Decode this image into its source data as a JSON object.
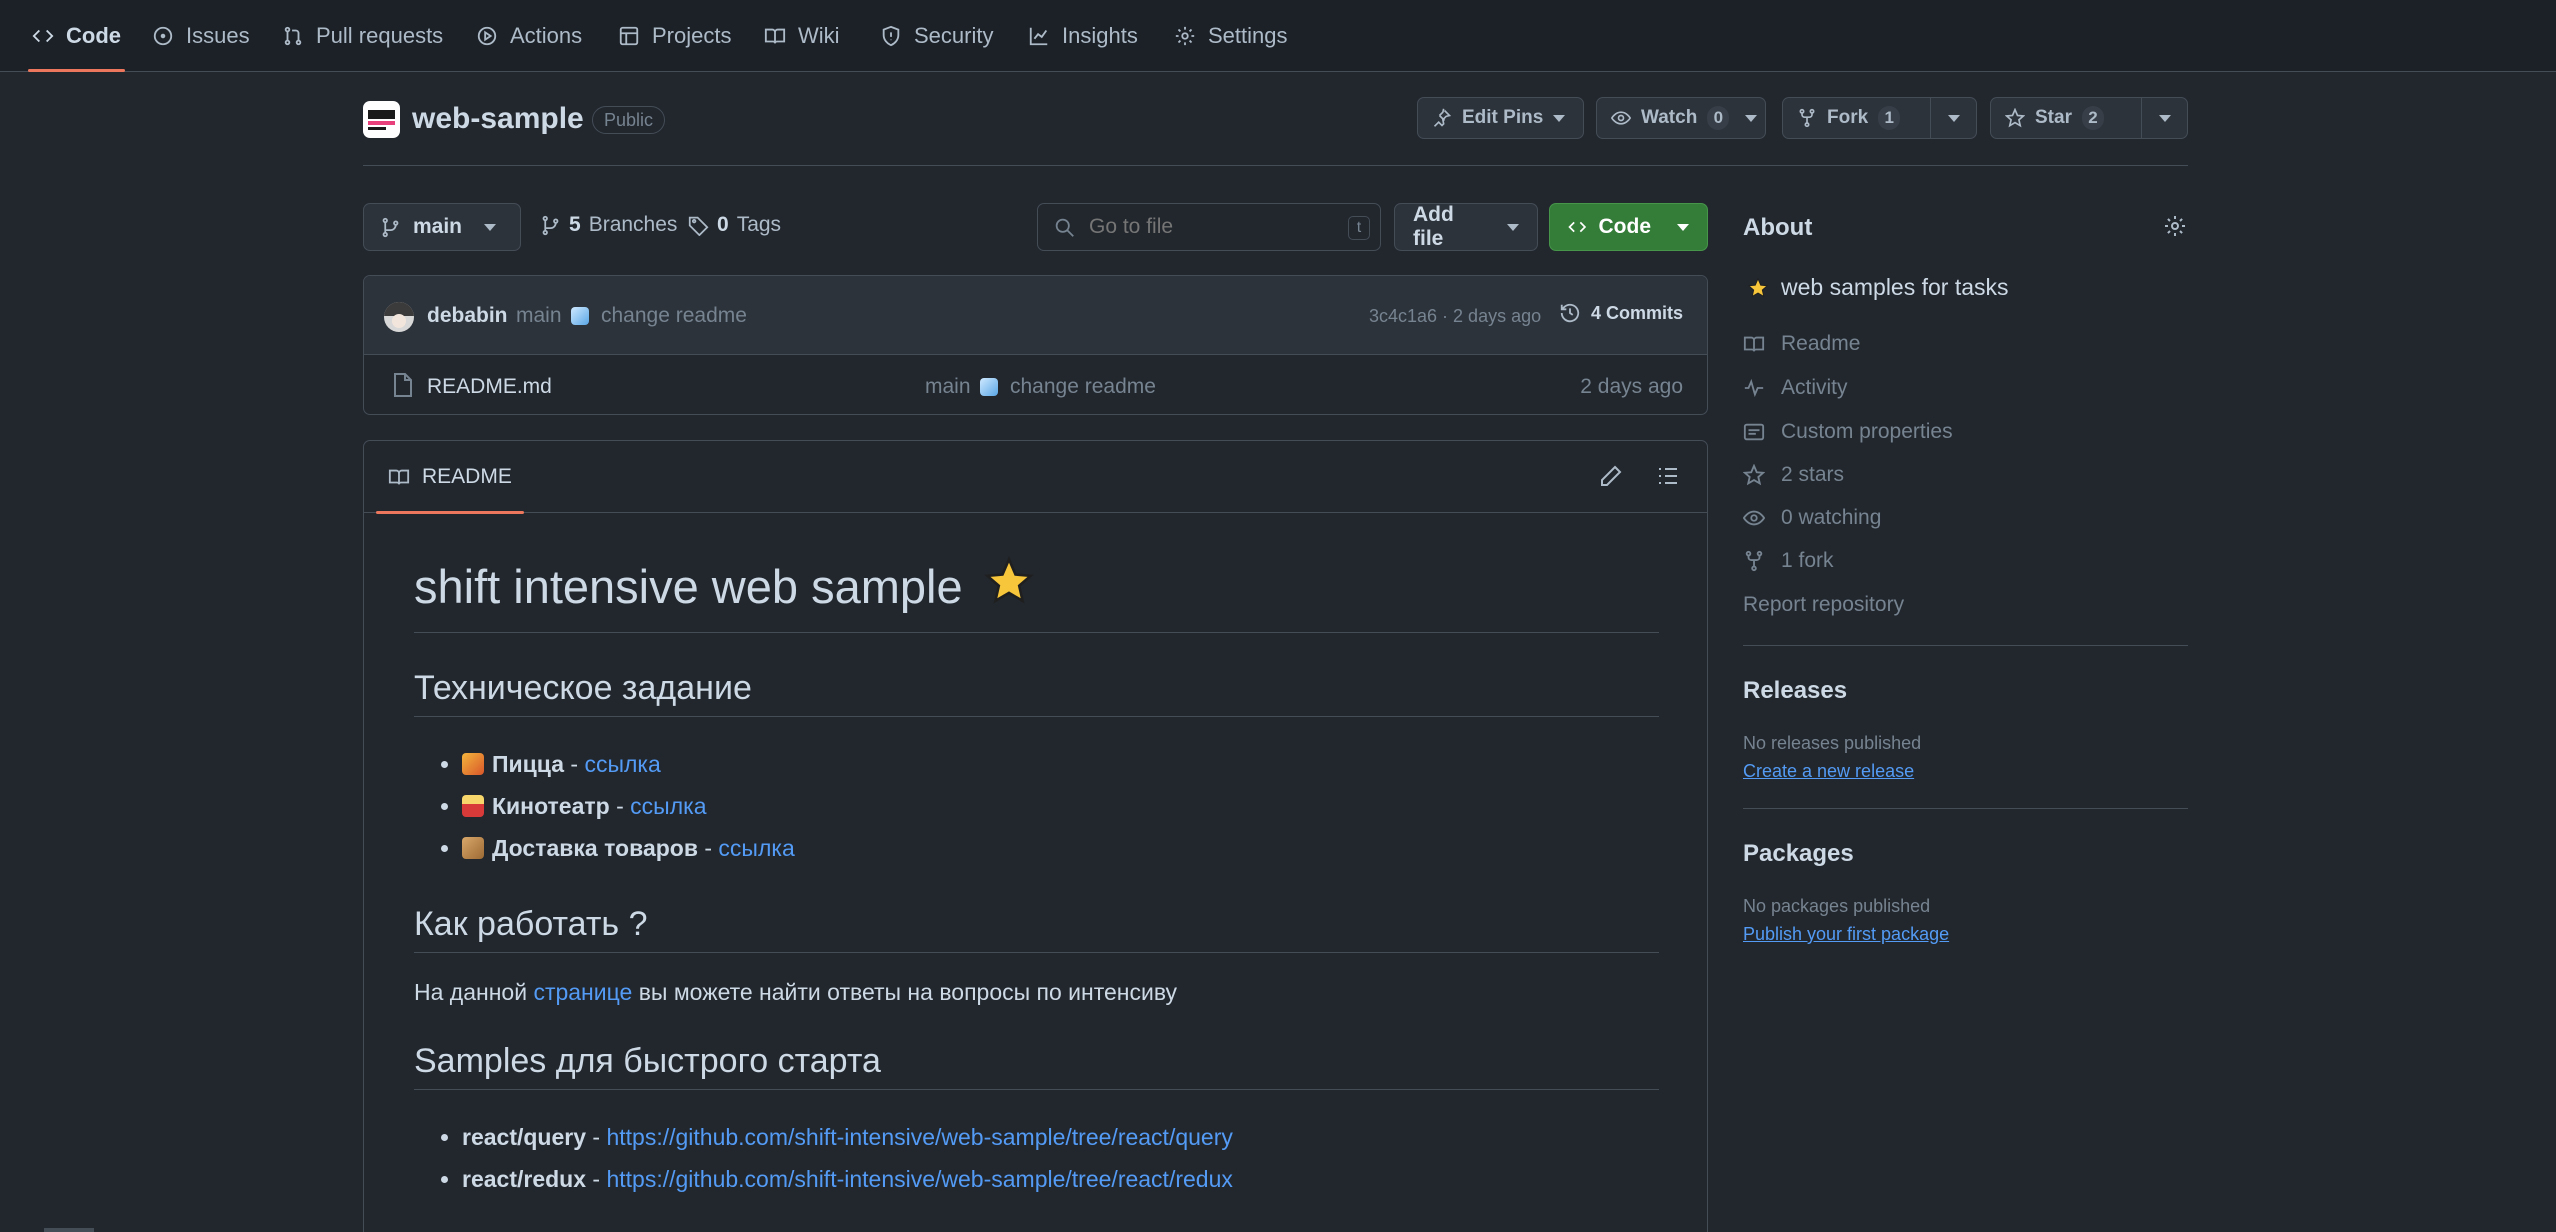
{
  "nav": {
    "tabs": [
      {
        "label": "Code",
        "icon": "code-icon"
      },
      {
        "label": "Issues",
        "icon": "issue-icon"
      },
      {
        "label": "Pull requests",
        "icon": "pull-request-icon"
      },
      {
        "label": "Actions",
        "icon": "play-icon"
      },
      {
        "label": "Projects",
        "icon": "table-icon"
      },
      {
        "label": "Wiki",
        "icon": "book-icon"
      },
      {
        "label": "Security",
        "icon": "shield-icon"
      },
      {
        "label": "Insights",
        "icon": "graph-icon"
      },
      {
        "label": "Settings",
        "icon": "gear-icon"
      }
    ],
    "active": "Code"
  },
  "repo": {
    "name": "web-sample",
    "visibility": "Public",
    "edit_pins_label": "Edit Pins",
    "watch_label": "Watch",
    "watch_count": "0",
    "fork_label": "Fork",
    "fork_count": "1",
    "star_label": "Star",
    "star_count": "2"
  },
  "toolbar": {
    "branch": "main",
    "branches_count": "5",
    "branches_label": "Branches",
    "tags_count": "0",
    "tags_label": "Tags",
    "search_placeholder": "Go to file",
    "search_shortcut": "t",
    "add_file_label": "Add file",
    "code_label": "Code"
  },
  "commit": {
    "author": "debabin",
    "branch": "main",
    "message": "change readme",
    "hash_time": "3c4c1a6 · 2 days ago",
    "commits_label": "4 Commits"
  },
  "files": [
    {
      "name": "README.md",
      "branch": "main",
      "message": "change readme",
      "time": "2 days ago"
    }
  ],
  "readme": {
    "tab_label": "README",
    "title": "shift intensive web sample",
    "h2_task": "Техническое задание",
    "tasks": [
      {
        "name": "Пицца",
        "sep": " - ",
        "link": "ссылка",
        "emoji": "pizza"
      },
      {
        "name": "Кинотеатр",
        "sep": " - ",
        "link": "ссылка",
        "emoji": "popcorn"
      },
      {
        "name": "Доставка товаров",
        "sep": " - ",
        "link": "ссылка",
        "emoji": "package"
      }
    ],
    "h2_how": "Как работать ?",
    "how_pre": "На данной ",
    "how_link": "странице",
    "how_post": " вы можете найти ответы на вопросы по интенсиву",
    "h2_samples": "Samples для быстрого старта",
    "samples": [
      {
        "name": "react/query",
        "sep": " - ",
        "url": "https://github.com/shift-intensive/web-sample/tree/react/query"
      },
      {
        "name": "react/redux",
        "sep": " - ",
        "url": "https://github.com/shift-intensive/web-sample/tree/react/redux"
      }
    ]
  },
  "about": {
    "title": "About",
    "description": "web samples for tasks",
    "items": [
      {
        "label": "Readme",
        "icon": "book-icon"
      },
      {
        "label": "Activity",
        "icon": "pulse-icon"
      },
      {
        "label": "Custom properties",
        "icon": "note-icon"
      },
      {
        "label": "2 stars",
        "icon": "star-icon"
      },
      {
        "label": "0 watching",
        "icon": "eye-icon"
      },
      {
        "label": "1 fork",
        "icon": "fork-icon"
      }
    ],
    "report": "Report repository"
  },
  "releases": {
    "title": "Releases",
    "empty": "No releases published",
    "link": "Create a new release"
  },
  "packages": {
    "title": "Packages",
    "empty": "No packages published",
    "link": "Publish your first package"
  },
  "colors": {
    "background": "#22272e",
    "accent_underline": "#ec775c",
    "link": "#539bf5",
    "code_button": "#347d39"
  }
}
